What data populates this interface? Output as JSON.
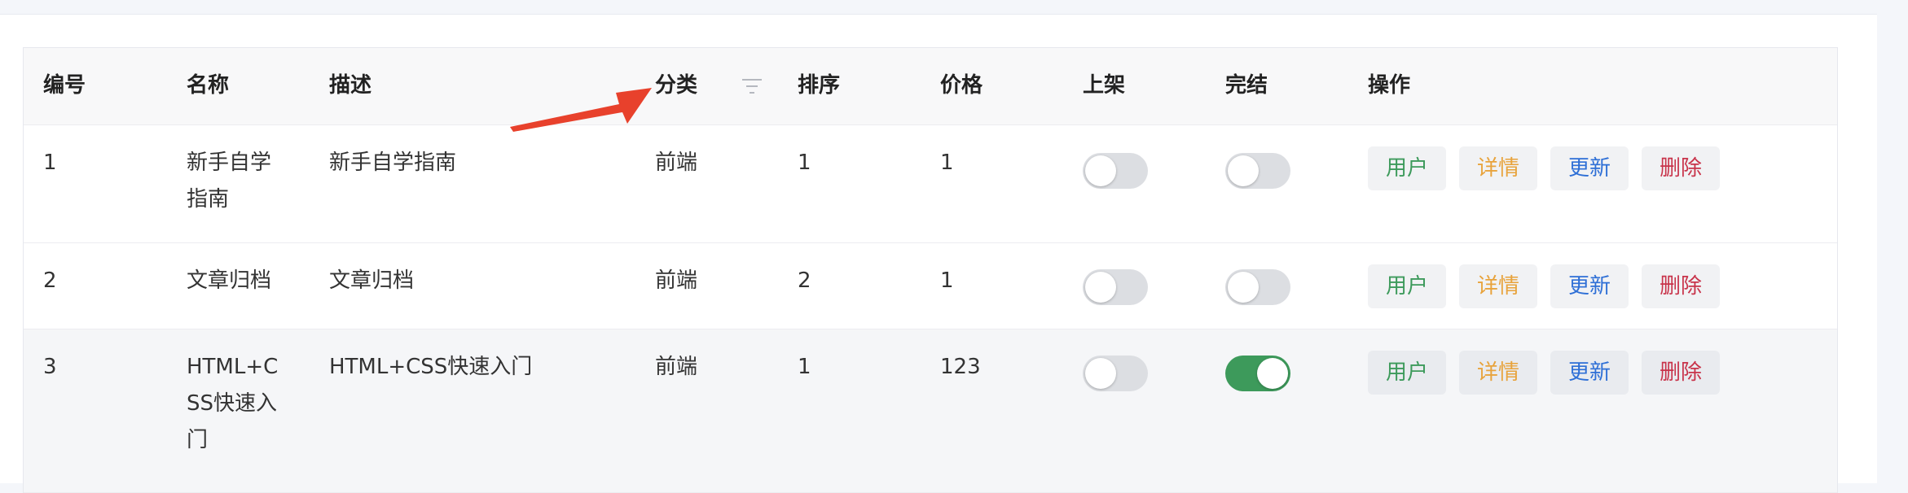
{
  "table": {
    "headers": {
      "id": "编号",
      "name": "名称",
      "desc": "描述",
      "category": "分类",
      "sort": "排序",
      "price": "价格",
      "published": "上架",
      "finished": "完结",
      "actions": "操作"
    },
    "rows": [
      {
        "id": "1",
        "name": "新手自学指南",
        "desc": "新手自学指南",
        "category": "前端",
        "sort": "1",
        "price": "1",
        "published": false,
        "finished": false
      },
      {
        "id": "2",
        "name": "文章归档",
        "desc": "文章归档",
        "category": "前端",
        "sort": "2",
        "price": "1",
        "published": false,
        "finished": false
      },
      {
        "id": "3",
        "name": "HTML+CSS快速入门",
        "desc": "HTML+CSS快速入门",
        "category": "前端",
        "sort": "1",
        "price": "123",
        "published": false,
        "finished": true
      }
    ],
    "action_labels": {
      "user": "用户",
      "detail": "详情",
      "update": "更新",
      "delete": "删除"
    }
  },
  "colors": {
    "toggle_on": "#3d9a5b",
    "user": "#3d9a5b",
    "detail": "#e8a33c",
    "update": "#2e6fd6",
    "delete": "#c8334a",
    "annotation_arrow": "#e8412c"
  },
  "icons": {
    "filter": "filter-icon",
    "annotation": "red-arrow-icon"
  }
}
